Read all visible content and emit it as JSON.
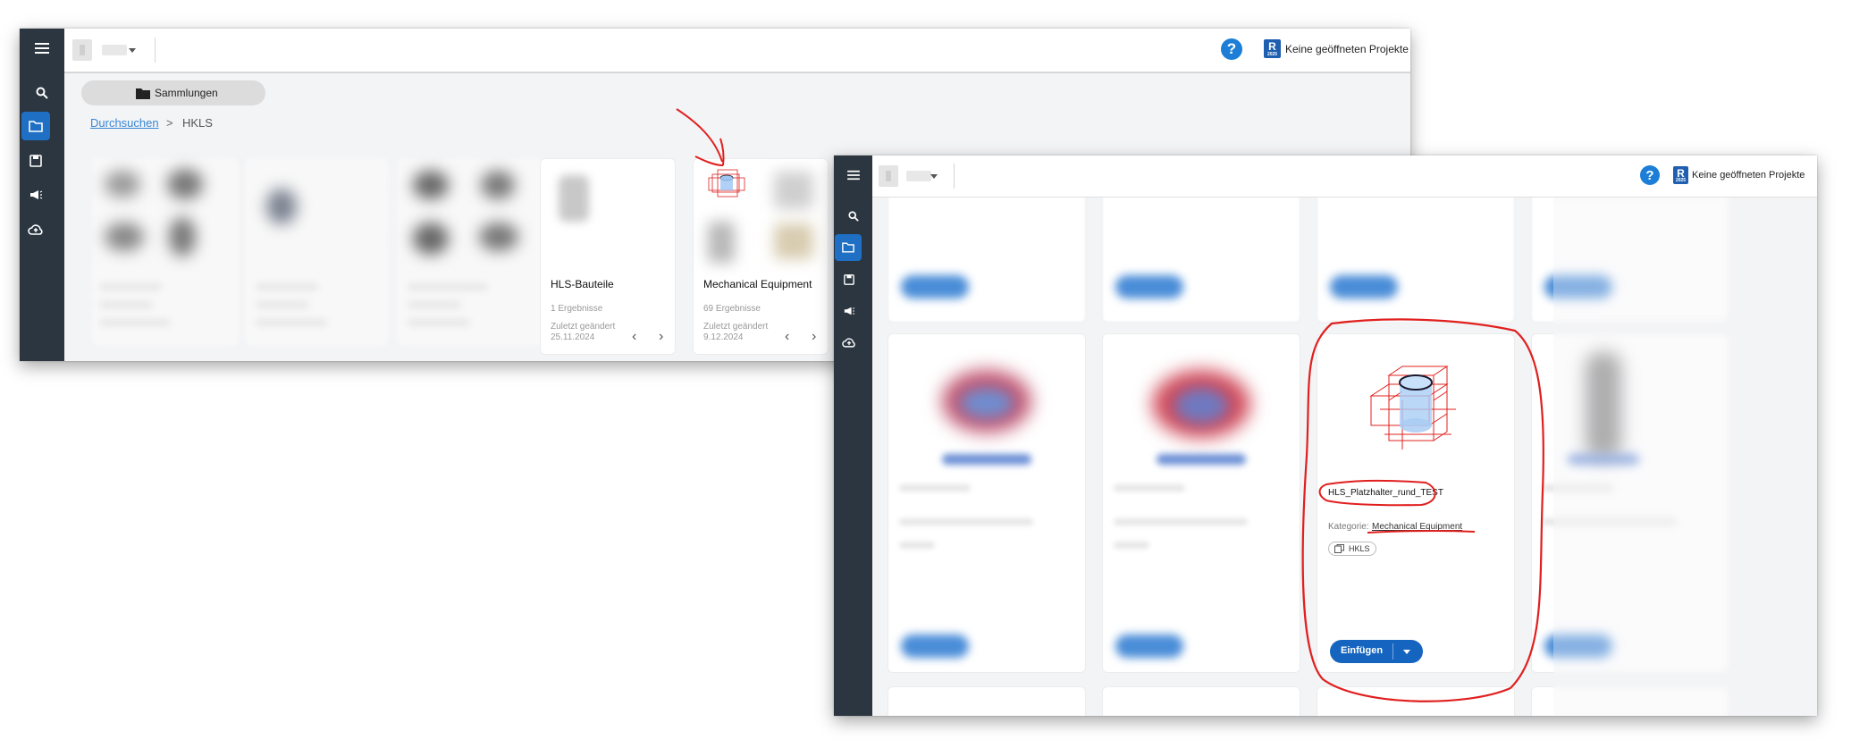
{
  "window1": {
    "topbar": {
      "help_label": "?",
      "revit_label": "R",
      "revit_sub": "2025",
      "projects_label": "Keine geöffneten Projekte"
    },
    "collections_button": "Sammlungen",
    "breadcrumb": {
      "root": "Durchsuchen",
      "separator": ">",
      "current": "HKLS"
    },
    "cards": [
      {
        "title": "HLS-Bauteile",
        "results": "1 Ergebnisse",
        "changed_label": "Zuletzt geändert",
        "changed_date": "25.11.2024"
      },
      {
        "title": "Mechanical Equipment",
        "results": "69 Ergebnisse",
        "changed_label": "Zuletzt geändert",
        "changed_date": "9.12.2024"
      }
    ],
    "prev_icon": "‹",
    "next_icon": "›"
  },
  "window2": {
    "topbar": {
      "help_label": "?",
      "revit_label": "R",
      "revit_sub": "2025",
      "projects_label": "Keine geöffneten Projekte"
    },
    "highlighted_card": {
      "name": "HLS_Platzhalter_rund_TEST",
      "category_label": "Kategorie:",
      "category_value": "Mechanical Equipment",
      "tag": "HKLS",
      "insert_button": "Einfügen"
    }
  },
  "colors": {
    "sidebar": "#2b3640",
    "accent": "#1f6fc4",
    "annotation": "#e0201f",
    "insert_button": "#1565c0"
  },
  "icons": [
    "menu-icon",
    "search-icon",
    "folder-icon",
    "save-icon",
    "megaphone-icon",
    "cloud-upload-icon",
    "help-icon",
    "revit-icon",
    "chevron-left-icon",
    "chevron-right-icon",
    "library-icon",
    "caret-down-icon"
  ]
}
